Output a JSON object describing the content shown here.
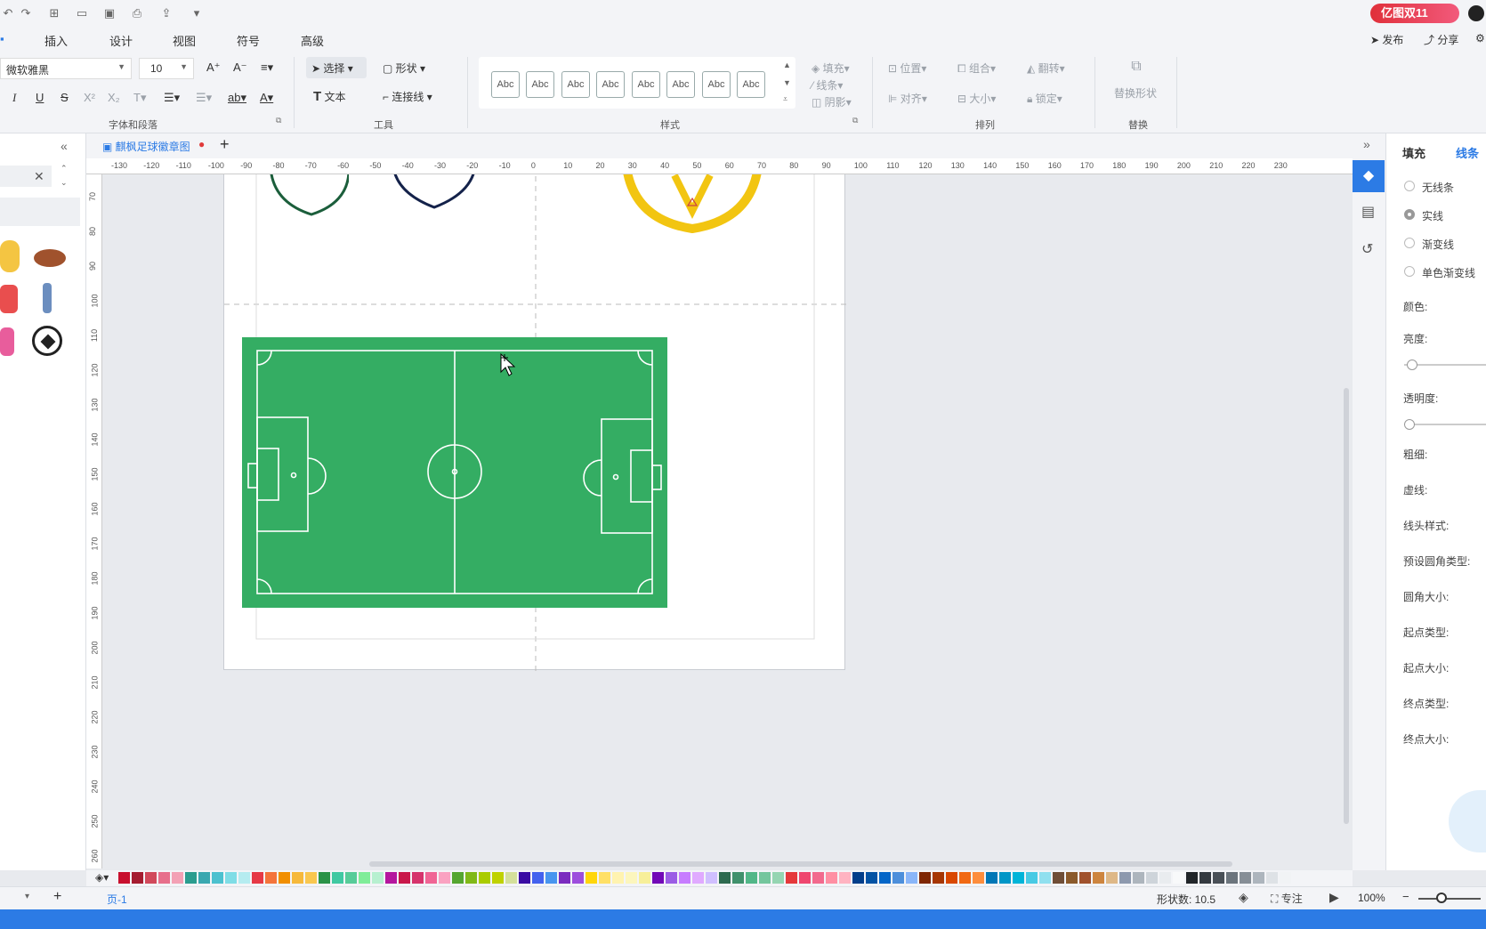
{
  "quick_access": {
    "icons": [
      "undo-icon",
      "redo-icon",
      "new-icon",
      "open-icon",
      "save-icon",
      "print-icon",
      "export-icon",
      "more-icon"
    ]
  },
  "promo_badge": "亿图双11",
  "menu": {
    "tabs": [
      "插入",
      "设计",
      "视图",
      "符号",
      "高级"
    ],
    "right": [
      "发布",
      "分享"
    ]
  },
  "font": {
    "name": "微软雅黑",
    "size": "10"
  },
  "tools": {
    "select": "选择",
    "shape": "形状",
    "text": "文本",
    "connector": "连接线"
  },
  "style_swatches": [
    "Abc",
    "Abc",
    "Abc",
    "Abc",
    "Abc",
    "Abc",
    "Abc",
    "Abc"
  ],
  "format": {
    "fill": "填充",
    "line": "线条",
    "shadow": "阴影"
  },
  "arrange": {
    "position": "位置",
    "group": "组合",
    "flip": "翻转",
    "align": "对齐",
    "size": "大小",
    "lock": "锁定"
  },
  "replace": {
    "label": "替换形状"
  },
  "groups": {
    "font": "字体和段落",
    "tools": "工具",
    "style": "样式",
    "arrange": "排列",
    "replace": "替换"
  },
  "document": {
    "tab_title": "麒枫足球徽章图"
  },
  "ruler": {
    "h_ticks": [
      "-130",
      "-120",
      "-110",
      "-100",
      "-90",
      "-80",
      "-70",
      "-60",
      "-50",
      "-40",
      "-30",
      "-20",
      "-10",
      "0",
      "10",
      "20",
      "30",
      "40",
      "50",
      "60",
      "70",
      "80",
      "90",
      "100",
      "110",
      "120",
      "130",
      "140",
      "150",
      "160",
      "170",
      "180",
      "190",
      "200",
      "210",
      "220",
      "230"
    ],
    "v_ticks": [
      "70",
      "80",
      "90",
      "100",
      "110",
      "120",
      "130",
      "140",
      "150",
      "160",
      "170",
      "180",
      "190",
      "200",
      "210",
      "220",
      "230",
      "240",
      "250",
      "260"
    ]
  },
  "right_panel": {
    "tabs": [
      "填充",
      "线条"
    ],
    "line_options": [
      "无线条",
      "实线",
      "渐变线",
      "单色渐变线"
    ],
    "properties": [
      "颜色:",
      "亮度:",
      "透明度:",
      "粗细:",
      "虚线:",
      "线头样式:",
      "预设圆角类型:",
      "圆角大小:",
      "起点类型:",
      "起点大小:",
      "终点类型:",
      "终点大小:"
    ]
  },
  "palette_colors": [
    "#c8102e",
    "#a51c30",
    "#d1495b",
    "#e76f8b",
    "#f3a1b5",
    "#2a9d8f",
    "#3aa8b0",
    "#4cc1cf",
    "#7fdde6",
    "#b5ecf0",
    "#e63946",
    "#f4743b",
    "#f18f01",
    "#f6b93b",
    "#f9c74f",
    "#2b9348",
    "#40c9a2",
    "#57cc99",
    "#80ed99",
    "#b7f0d0",
    "#b5179e",
    "#c9184a",
    "#d6336c",
    "#f06595",
    "#faa2c1",
    "#55a630",
    "#80b918",
    "#aacc00",
    "#bfd200",
    "#d4e09b",
    "#3a0ca3",
    "#4361ee",
    "#4895ef",
    "#7b2cbf",
    "#9d4edd",
    "#ffd60a",
    "#ffe066",
    "#fff3b0",
    "#fcf6bd",
    "#f7ef99",
    "#7209b7",
    "#9b5de5",
    "#c77dff",
    "#e0aaff",
    "#d0bfff",
    "#2d6a4f",
    "#40916c",
    "#52b788",
    "#74c69d",
    "#95d5b2",
    "#e5383b",
    "#ef476f",
    "#f26a8d",
    "#ff8fa3",
    "#ffb3c1",
    "#023e8a",
    "#0353a4",
    "#0466c8",
    "#4d8fdb",
    "#8ab6f9",
    "#7f2704",
    "#a63603",
    "#d94801",
    "#f16913",
    "#fd8d3c",
    "#0077b6",
    "#0096c7",
    "#00b4d8",
    "#48cae4",
    "#90e0ef",
    "#6f4e37",
    "#8b5a2b",
    "#a0522d",
    "#cd853f",
    "#deb887",
    "#8d99ae",
    "#adb5bd",
    "#ced4da",
    "#e9ecef",
    "#f8f9fa",
    "#212529",
    "#343a40",
    "#495057",
    "#6c757d",
    "#868e96",
    "#adb5bd",
    "#dee2e6",
    "#f1f3f5"
  ],
  "status": {
    "page_tab": "页-1",
    "shape_count": "形状数: 10.5",
    "focus": "专注",
    "zoom": "100%"
  }
}
